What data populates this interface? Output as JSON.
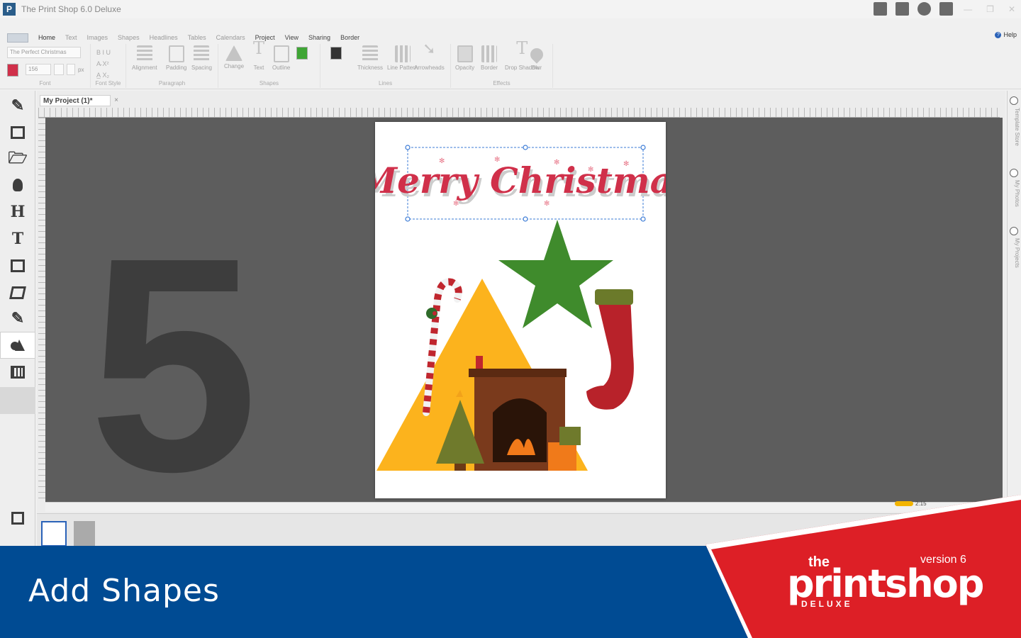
{
  "window": {
    "title": "The Print Shop 6.0 Deluxe",
    "app_icon": "P",
    "controls": [
      "—",
      "❐",
      "✕"
    ],
    "quick_tools": [
      "save-icon",
      "print-icon",
      "quick-search-icon",
      "mail-icon"
    ]
  },
  "ribbon": {
    "tabs": [
      "Home",
      "Text",
      "Images",
      "Shapes",
      "Headlines",
      "Tables",
      "Calendars",
      "Project",
      "View",
      "Sharing",
      "Border"
    ],
    "active_tab": "Shapes",
    "help": "Help",
    "help_glyph": "?",
    "font_name": "The Perfect Christmas",
    "font_size": "156",
    "unit": "px",
    "font_style_glyphs": [
      "B I U",
      "A̵ X²",
      "A̲ X₂"
    ],
    "groups": {
      "font": "Font",
      "font_style": "Font Style",
      "paragraph": "Paragraph",
      "shapes": "Shapes",
      "lines": "Lines",
      "effects": "Effects"
    },
    "buttons": {
      "alignment": "Alignment",
      "padding": "Padding",
      "spacing": "Spacing",
      "change": "Change",
      "text": "Text",
      "outline": "Outline",
      "thickness": "Thickness",
      "line_pattern": "Line Pattern",
      "arrowheads": "Arrowheads",
      "opacity": "Opacity",
      "border": "Border",
      "drop_shadow": "Drop Shadow",
      "blur": "Blur"
    },
    "colors": {
      "text_color": "#d0304a",
      "fill_color": "#3fa535",
      "line_color": "#333333"
    }
  },
  "sidebar": {
    "tools": [
      "pencil-icon",
      "layout-icon",
      "open-folder-icon",
      "idea-bulb-icon",
      "headline-icon",
      "text-icon",
      "image-icon",
      "photos-icon",
      "edit-pen-icon",
      "shapes-icon",
      "calendar-icon"
    ],
    "active_tool": "shapes-icon",
    "headline_glyph": "H",
    "text_glyph": "T"
  },
  "document": {
    "tab_label": "My Project (1)*",
    "close_glyph": "×",
    "step_number": "5",
    "headline_text": "Merry Christmas",
    "zoom_readout": "2:15",
    "shapes": {
      "triangle_color": "#fcb31d",
      "star_color": "#3f8b2c"
    }
  },
  "right_panel": [
    "Template Store",
    "My Photos",
    "My Projects"
  ],
  "banner": {
    "title": "Add Shapes",
    "logo_the": "the",
    "logo_main": "printshop",
    "logo_deluxe": "DELUXE",
    "logo_version": "version 6",
    "colors": {
      "blue": "#004b93",
      "red": "#dd1f26"
    }
  }
}
